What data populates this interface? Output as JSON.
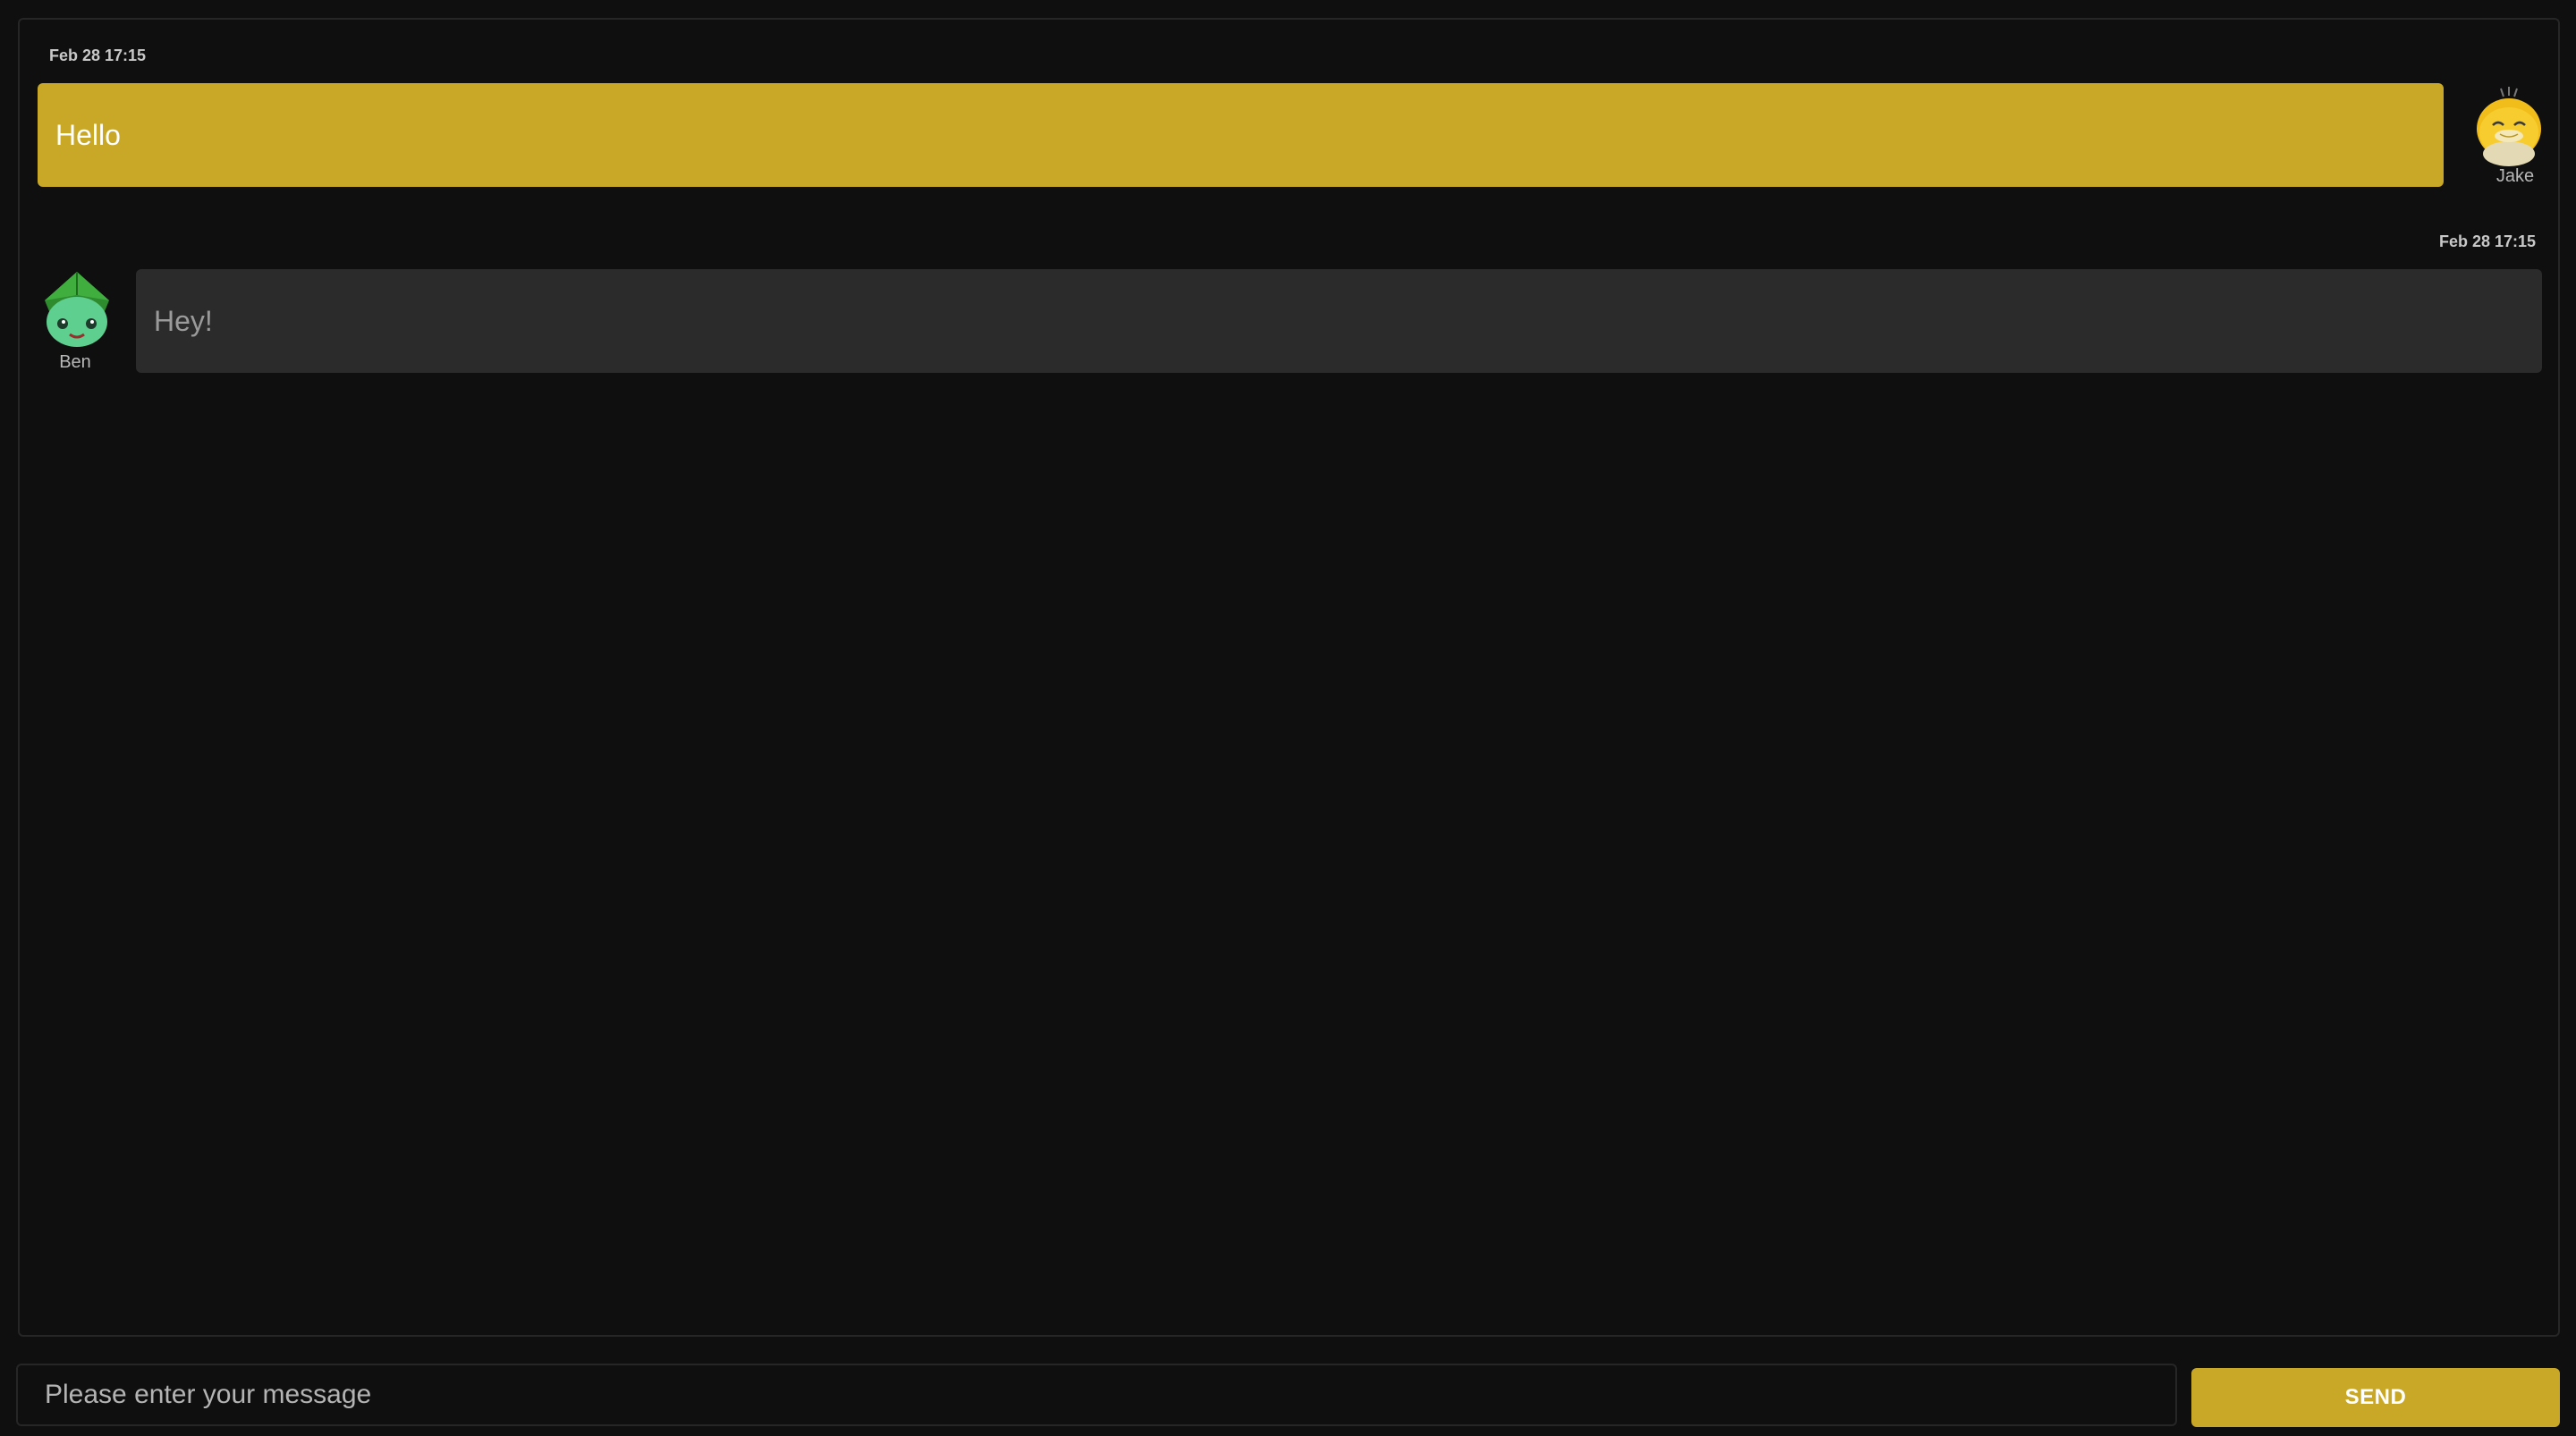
{
  "messages": [
    {
      "timestamp": "Feb 28 17:15",
      "text": "Hello",
      "sender": "Jake",
      "avatar_icon": "yellow-duck-avatar-icon",
      "outgoing": true,
      "bubble_color": "#c9a827"
    },
    {
      "timestamp": "Feb 28 17:15",
      "text": "Hey!",
      "sender": "Ben",
      "avatar_icon": "green-frog-avatar-icon",
      "outgoing": false,
      "bubble_color": "#2b2b2b"
    }
  ],
  "composer": {
    "placeholder": "Please enter your message",
    "value": ""
  },
  "send_button": {
    "label": "SEND"
  },
  "colors": {
    "background": "#0f0f0f",
    "accent": "#c9a827",
    "incoming_bubble": "#2b2b2b"
  }
}
